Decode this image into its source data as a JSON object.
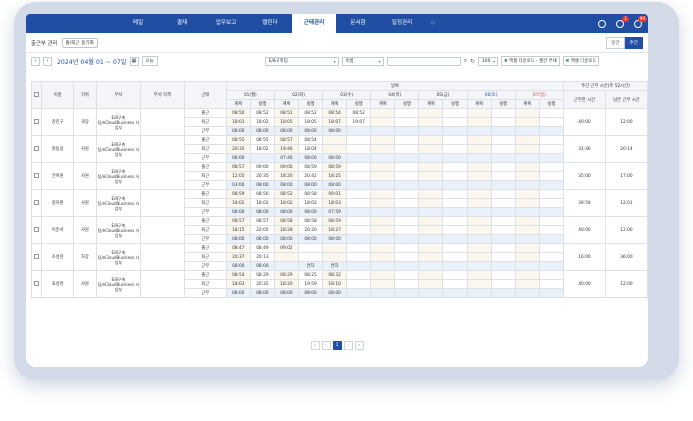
{
  "nav": {
    "menu": [
      "메일",
      "결재",
      "업무보고",
      "캘린더",
      "근태관리",
      "문서함",
      "일정관리"
    ],
    "active_index": 4,
    "notifications": "1",
    "messages": "99"
  },
  "subbar": {
    "title": "출근부 관리",
    "filter_pill": "출/퇴근 동기화",
    "views": [
      "일간",
      "주간"
    ],
    "active_view": "주간"
  },
  "toolbar": {
    "date_range": "2024년 04월 01 ~ 07일",
    "today_label": "오늘",
    "dept_select": "E/8구축팀",
    "name_select": "이름",
    "page_size": "100",
    "excel_weekly": "엑셀 다운로드 - 월간 부재",
    "excel_download": "엑셀 다운로드"
  },
  "table": {
    "headers": {
      "name": "이름",
      "position": "직위",
      "dept": "부서",
      "dept_role": "부서 직책",
      "type": "근태",
      "date_group": "날짜",
      "summary_group": "주간 근무 시간(주 52시간)",
      "worked": "근무한 시간",
      "remaining": "남은 근무 시간"
    },
    "days": [
      "01(월)",
      "02(화)",
      "03(수)",
      "04(목)",
      "05(금)",
      "06(토)",
      "07(일)"
    ],
    "sub": [
      "계획",
      "실행"
    ],
    "rows": [
      {
        "name": "강진구",
        "position": "과장",
        "dept": "E/8구축팀/eCloudBusiness 사업부",
        "lines": [
          {
            "type": "출근",
            "cells": [
              "08:50",
              "08:52",
              "08:51",
              "08:52",
              "08:54",
              "08:52",
              "",
              "",
              "",
              "",
              "",
              "",
              "",
              ""
            ]
          },
          {
            "type": "퇴근",
            "cells": [
              "18:01",
              "18:02",
              "18:05",
              "18:05",
              "18:07",
              "19:07",
              "",
              "",
              "",
              "",
              "",
              "",
              "",
              ""
            ]
          },
          {
            "type": "근무",
            "cells": [
              "08:00",
              "08:00",
              "08:00",
              "08:00",
              "08:00",
              "",
              "",
              "",
              "",
              "",
              "",
              "",
              "",
              ""
            ]
          }
        ],
        "worked": "40:00",
        "remaining": "12:00"
      },
      {
        "name": "원동용",
        "position": "사원",
        "dept": "E/8구축팀/eCloudBusiness 사업부",
        "lines": [
          {
            "type": "출근",
            "cells": [
              "08:55",
              "08:55",
              "08:57",
              "08:54",
              "",
              "",
              "",
              "",
              "",
              "",
              "",
              "",
              "",
              ""
            ]
          },
          {
            "type": "퇴근",
            "cells": [
              "20:35",
              "18:02",
              "19:46",
              "18:04",
              "",
              "",
              "",
              "",
              "",
              "",
              "",
              "",
              "",
              ""
            ]
          },
          {
            "type": "근무",
            "cells": [
              "08:00",
              "",
              "07:46",
              "08:00",
              "08:00",
              "",
              "",
              "",
              "",
              "",
              "",
              "",
              "",
              ""
            ]
          }
        ],
        "worked": "31:46",
        "remaining": "20:14"
      },
      {
        "name": "전여원",
        "position": "사원",
        "dept": "E/8구축팀/eCloudBusiness 사업부",
        "lines": [
          {
            "type": "출근",
            "cells": [
              "08:57",
              "09:00",
              "09:00",
              "08:59",
              "08:59",
              "",
              "",
              "",
              "",
              "",
              "",
              "",
              "",
              ""
            ]
          },
          {
            "type": "퇴근",
            "cells": [
              "12:05",
              "20:35",
              "18:20",
              "20:42",
              "18:25",
              "",
              "",
              "",
              "",
              "",
              "",
              "",
              "",
              ""
            ]
          },
          {
            "type": "근무",
            "cells": [
              "03:00",
              "08:00",
              "08:00",
              "08:00",
              "08:00",
              "",
              "",
              "",
              "",
              "",
              "",
              "",
              "",
              ""
            ]
          }
        ],
        "worked": "35:00",
        "remaining": "17:00"
      },
      {
        "name": "정지환",
        "position": "사원",
        "dept": "E/8구축팀/eCloudBusiness 사업부",
        "lines": [
          {
            "type": "출근",
            "cells": [
              "08:59",
              "08:56",
              "08:52",
              "08:58",
              "09:01",
              "",
              "",
              "",
              "",
              "",
              "",
              "",
              "",
              ""
            ]
          },
          {
            "type": "퇴근",
            "cells": [
              "18:02",
              "18:02",
              "18:02",
              "18:02",
              "18:03",
              "",
              "",
              "",
              "",
              "",
              "",
              "",
              "",
              ""
            ]
          },
          {
            "type": "근무",
            "cells": [
              "08:00",
              "08:00",
              "08:00",
              "08:00",
              "07:59",
              "",
              "",
              "",
              "",
              "",
              "",
              "",
              "",
              ""
            ]
          }
        ],
        "worked": "39:59",
        "remaining": "12:01"
      },
      {
        "name": "이준서",
        "position": "사원",
        "dept": "E/8구축팀/eCloudBusiness 사업부",
        "lines": [
          {
            "type": "출근",
            "cells": [
              "08:57",
              "08:57",
              "08:58",
              "08:58",
              "08:59",
              "",
              "",
              "",
              "",
              "",
              "",
              "",
              "",
              ""
            ]
          },
          {
            "type": "퇴근",
            "cells": [
              "18:15",
              "22:05",
              "18:28",
              "20:20",
              "18:27",
              "",
              "",
              "",
              "",
              "",
              "",
              "",
              "",
              ""
            ]
          },
          {
            "type": "근무",
            "cells": [
              "08:00",
              "08:00",
              "08:00",
              "08:00",
              "08:00",
              "",
              "",
              "",
              "",
              "",
              "",
              "",
              "",
              ""
            ]
          }
        ],
        "worked": "40:00",
        "remaining": "12:00"
      },
      {
        "name": "조성현",
        "position": "차장",
        "dept": "E/8구축팀/eCloudBusiness 사업부",
        "lines": [
          {
            "type": "출근",
            "cells": [
              "08:47",
              "08:49",
              "09:02",
              "",
              "",
              "",
              "",
              "",
              "",
              "",
              "",
              "",
              "",
              ""
            ]
          },
          {
            "type": "퇴근",
            "cells": [
              "20:37",
              "20:13",
              "",
              "",
              "",
              "",
              "",
              "",
              "",
              "",
              "",
              "",
              "",
              ""
            ]
          },
          {
            "type": "근무",
            "cells": [
              "08:00",
              "08:00",
              "",
              "연차",
              "연차",
              "",
              "",
              "",
              "",
              "",
              "",
              "",
              "",
              ""
            ]
          }
        ],
        "worked": "16:00",
        "remaining": "36:00"
      },
      {
        "name": "효성현",
        "position": "사원",
        "dept": "E/8구축팀/eCloudBusiness 사업부",
        "lines": [
          {
            "type": "출근",
            "cells": [
              "08:54",
              "08:29",
              "08:29",
              "08:25",
              "08:32",
              "",
              "",
              "",
              "",
              "",
              "",
              "",
              "",
              ""
            ]
          },
          {
            "type": "퇴근",
            "cells": [
              "18:03",
              "20:35",
              "18:20",
              "19:59",
              "18:10",
              "",
              "",
              "",
              "",
              "",
              "",
              "",
              "",
              ""
            ]
          },
          {
            "type": "근무",
            "cells": [
              "08:00",
              "08:00",
              "08:00",
              "08:00",
              "08:00",
              "",
              "",
              "",
              "",
              "",
              "",
              "",
              "",
              ""
            ]
          }
        ],
        "worked": "40:00",
        "remaining": "12:00"
      }
    ]
  },
  "pager": {
    "first": "«",
    "prev": "‹",
    "current": "1",
    "next": "›",
    "last": "»"
  }
}
